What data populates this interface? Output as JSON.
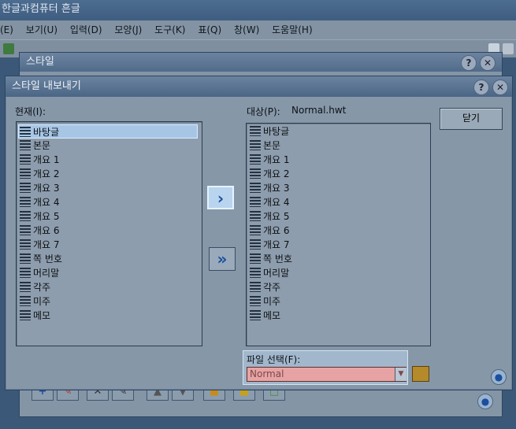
{
  "app": {
    "title": "한글과컴퓨터 흔글",
    "menus": [
      "(E)",
      "보기(U)",
      "입력(D)",
      "모양(J)",
      "도구(K)",
      "표(Q)",
      "창(W)",
      "도움말(H)"
    ]
  },
  "style_dialog": {
    "title": "스타일",
    "help_label": "?",
    "close_label": "✕"
  },
  "export_dialog": {
    "title": "스타일 내보내기",
    "help_label": "?",
    "close_label": "✕",
    "current_label": "현재(I):",
    "target_label": "대상(P):",
    "target_file": "Normal.hwt",
    "close_button": "닫기",
    "copy_one_label": "›",
    "copy_all_label": "»",
    "current_items": [
      "바탕글",
      "본문",
      "개요 1",
      "개요 2",
      "개요 3",
      "개요 4",
      "개요 5",
      "개요 6",
      "개요 7",
      "쪽 번호",
      "머리말",
      "각주",
      "미주",
      "메모"
    ],
    "target_items": [
      "바탕글",
      "본문",
      "개요 1",
      "개요 2",
      "개요 3",
      "개요 4",
      "개요 5",
      "개요 6",
      "개요 7",
      "쪽 번호",
      "머리말",
      "각주",
      "미주",
      "메모"
    ],
    "selected_index": 0,
    "file_select_label": "파일 선택(F):",
    "file_select_value": "Normal",
    "dropdown_arrow": "▼"
  },
  "colors": {
    "selection": "#a7c6e6",
    "file_select_bg": "#e7a3a3",
    "arrow_icon": "#1a4f9e"
  }
}
